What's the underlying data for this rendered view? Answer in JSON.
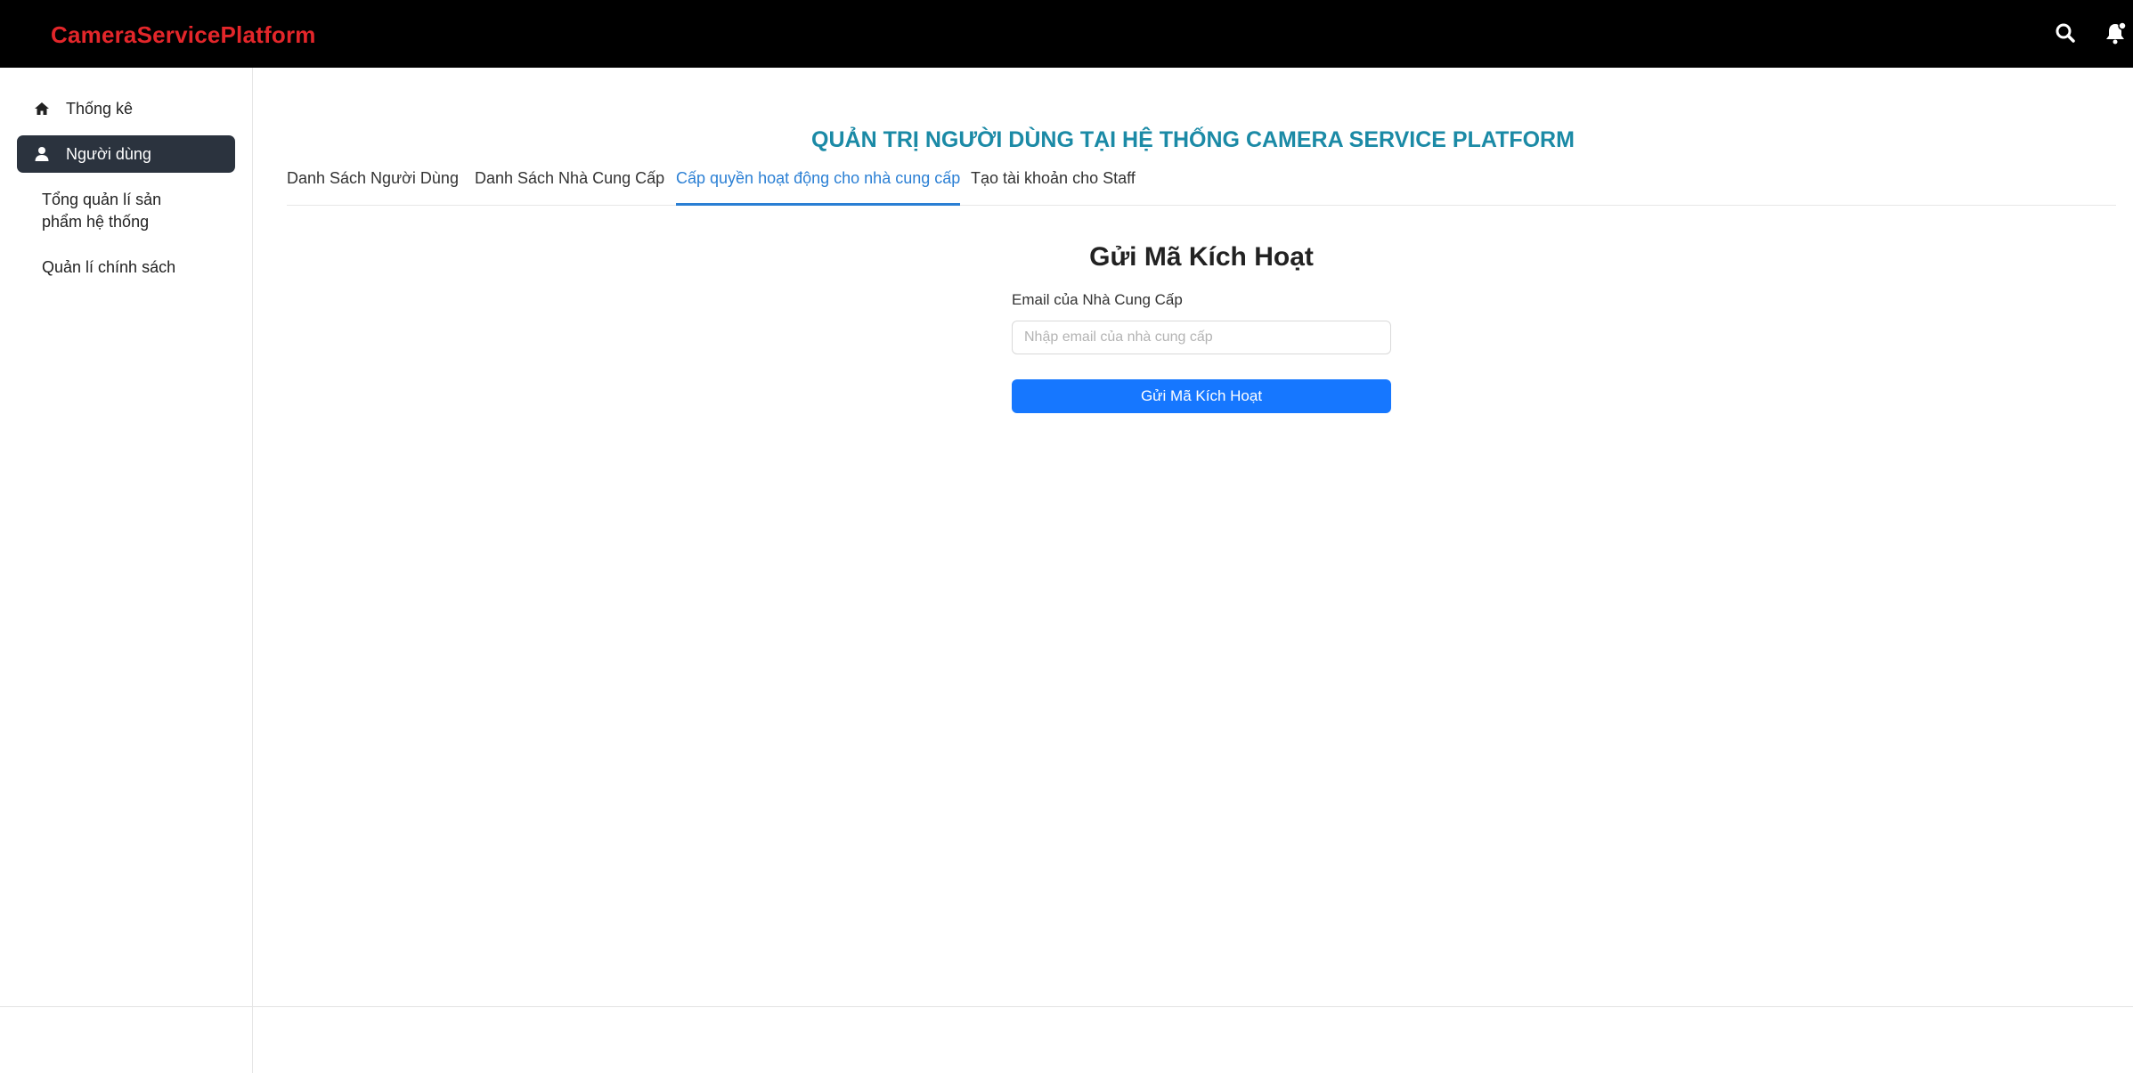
{
  "header": {
    "brand": "CameraServicePlatform",
    "search_icon": "search-icon",
    "notification_icon": "bell-icon",
    "brand_color": "#e3262a"
  },
  "sidebar": {
    "items": [
      {
        "label": "Thống kê",
        "icon": "home-icon",
        "active": false
      },
      {
        "label": "Người dùng",
        "icon": "user-icon",
        "active": true
      },
      {
        "label": "Tổng quản lí sản phẩm hệ thống",
        "icon": "",
        "active": false
      },
      {
        "label": "Quản lí chính sách",
        "icon": "",
        "active": false
      }
    ],
    "active_color": "#2b333e"
  },
  "main": {
    "title": "QUẢN TRỊ NGƯỜI DÙNG TẠI HỆ THỐNG CAMERA SERVICE PLATFORM",
    "title_color": "#1b8aa6",
    "tabs": [
      {
        "label": "Danh Sách Người Dùng",
        "active": false
      },
      {
        "label": "Danh Sách Nhà Cung Cấp",
        "active": false
      },
      {
        "label": "Cấp quyền hoạt động cho nhà cung cấp",
        "active": true
      },
      {
        "label": "Tạo tài khoản cho Staff",
        "active": false
      }
    ],
    "active_tab_color": "#2a7fd4"
  },
  "form": {
    "title": "Gửi Mã Kích Hoạt",
    "email_label": "Email của Nhà Cung Cấp",
    "email_value": "",
    "email_placeholder": "Nhập email của nhà cung cấp",
    "submit_label": "Gửi Mã Kích Hoạt",
    "button_color": "#1677ff"
  }
}
